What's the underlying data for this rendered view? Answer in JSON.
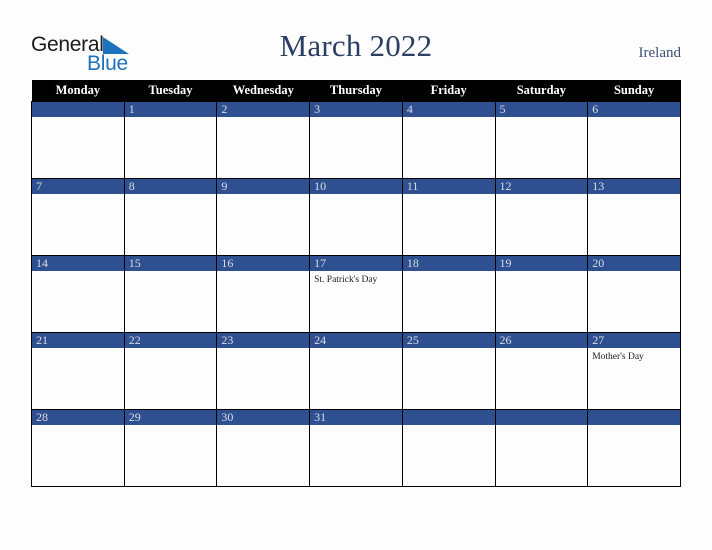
{
  "brand": {
    "name_part1": "General",
    "name_part2": "Blue",
    "triangle_color": "#1d72bd",
    "text_color": "#1c1c1c"
  },
  "header": {
    "title": "March 2022",
    "region": "Ireland",
    "title_color": "#2c3e63",
    "region_color": "#3b4f77"
  },
  "calendar": {
    "month": "March",
    "year": "2022",
    "accent_color": "#2f5090",
    "header_bg": "#000000",
    "header_text_color": "#ffffff",
    "weekday_headers": [
      "Monday",
      "Tuesday",
      "Wednesday",
      "Thursday",
      "Friday",
      "Saturday",
      "Sunday"
    ],
    "weeks": [
      [
        {
          "day": "",
          "event": ""
        },
        {
          "day": "1",
          "event": ""
        },
        {
          "day": "2",
          "event": ""
        },
        {
          "day": "3",
          "event": ""
        },
        {
          "day": "4",
          "event": ""
        },
        {
          "day": "5",
          "event": ""
        },
        {
          "day": "6",
          "event": ""
        }
      ],
      [
        {
          "day": "7",
          "event": ""
        },
        {
          "day": "8",
          "event": ""
        },
        {
          "day": "9",
          "event": ""
        },
        {
          "day": "10",
          "event": ""
        },
        {
          "day": "11",
          "event": ""
        },
        {
          "day": "12",
          "event": ""
        },
        {
          "day": "13",
          "event": ""
        }
      ],
      [
        {
          "day": "14",
          "event": ""
        },
        {
          "day": "15",
          "event": ""
        },
        {
          "day": "16",
          "event": ""
        },
        {
          "day": "17",
          "event": "St. Patrick's Day"
        },
        {
          "day": "18",
          "event": ""
        },
        {
          "day": "19",
          "event": ""
        },
        {
          "day": "20",
          "event": ""
        }
      ],
      [
        {
          "day": "21",
          "event": ""
        },
        {
          "day": "22",
          "event": ""
        },
        {
          "day": "23",
          "event": ""
        },
        {
          "day": "24",
          "event": ""
        },
        {
          "day": "25",
          "event": ""
        },
        {
          "day": "26",
          "event": ""
        },
        {
          "day": "27",
          "event": "Mother's Day"
        }
      ],
      [
        {
          "day": "28",
          "event": ""
        },
        {
          "day": "29",
          "event": ""
        },
        {
          "day": "30",
          "event": ""
        },
        {
          "day": "31",
          "event": ""
        },
        {
          "day": "",
          "event": ""
        },
        {
          "day": "",
          "event": ""
        },
        {
          "day": "",
          "event": ""
        }
      ]
    ]
  }
}
